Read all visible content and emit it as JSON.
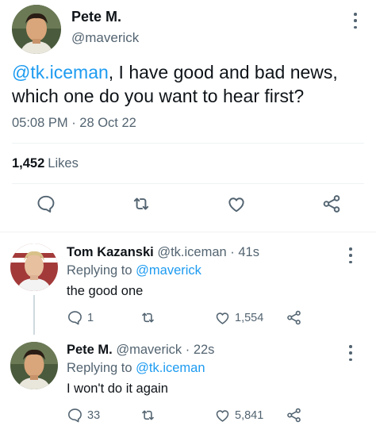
{
  "main_tweet": {
    "author_name": "Pete M.",
    "author_handle": "@maverick",
    "mention": "@tk.iceman",
    "text_after_mention": ", I have good and bad news, which one do you want to hear first?",
    "timestamp": "05:08 PM · 28 Oct 22",
    "likes_count": "1,452",
    "likes_label": "Likes",
    "actions": [
      "reply-icon",
      "retweet-icon",
      "like-icon",
      "share-icon"
    ]
  },
  "replies": [
    {
      "author_name": "Tom Kazanski",
      "author_handle": "@tk.iceman",
      "time": "· 41s",
      "replying_label": "Replying to",
      "replying_to": "@maverick",
      "text": "the good one",
      "reply_count": "1",
      "retweet_count": "",
      "like_count": "1,554"
    },
    {
      "author_name": "Pete M.",
      "author_handle": "@maverick",
      "time": "· 22s",
      "replying_label": "Replying to",
      "replying_to": "@tk.iceman",
      "text": "I won't do it again",
      "reply_count": "33",
      "retweet_count": "",
      "like_count": "5,841"
    }
  ],
  "colors": {
    "accent": "#1d9bf0",
    "text_primary": "#0f1419",
    "text_secondary": "#536471",
    "divider": "#eff3f4"
  }
}
